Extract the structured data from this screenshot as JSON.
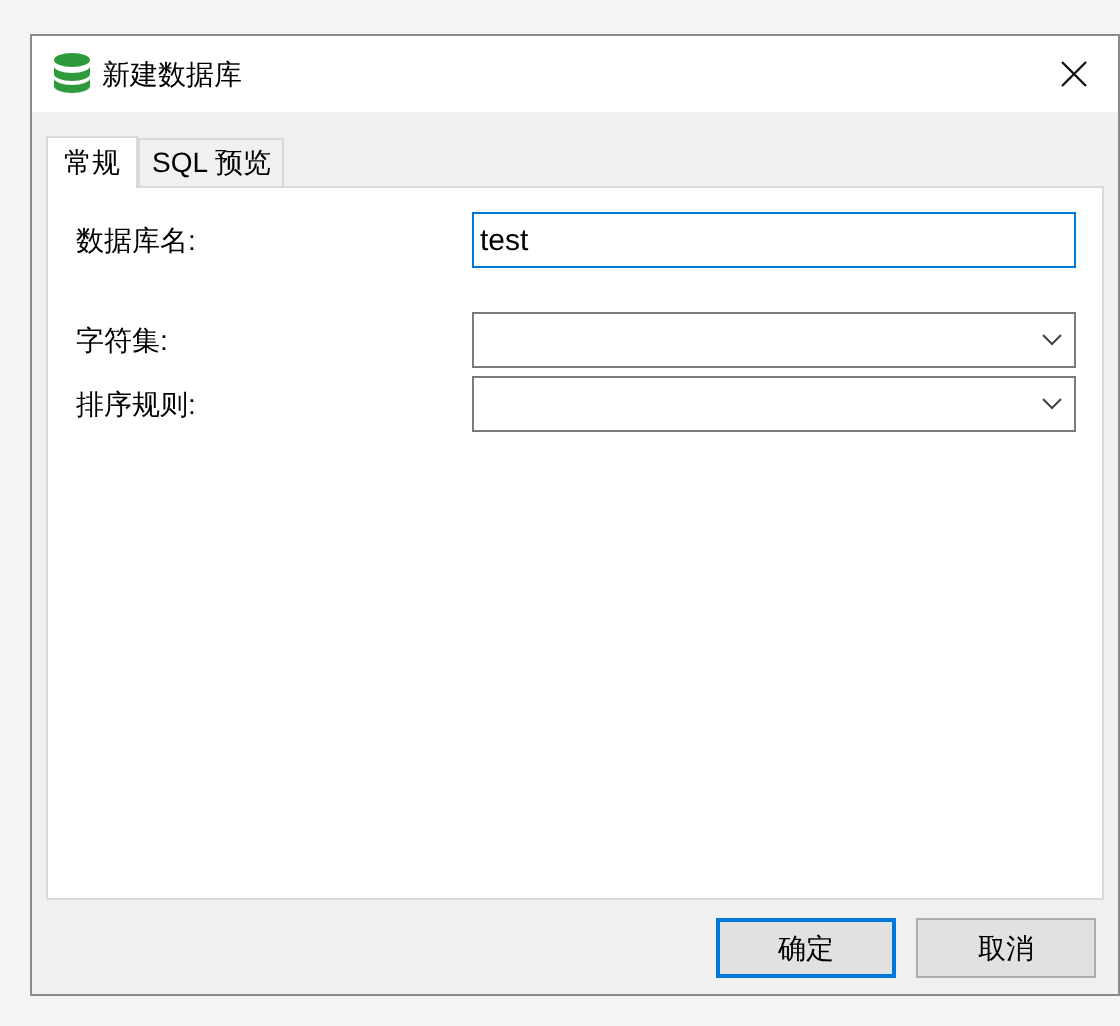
{
  "window": {
    "title": "新建数据库"
  },
  "tabs": [
    {
      "label": "常规",
      "selected": true
    },
    {
      "label": "SQL 预览",
      "selected": false
    }
  ],
  "fields": [
    {
      "kind": "text",
      "label": "数据库名:",
      "value": "test",
      "focused": true
    },
    {
      "kind": "select",
      "label": "字符集:",
      "focused": false
    },
    {
      "kind": "select",
      "label": "排序规则:",
      "focused": false
    }
  ],
  "buttons": [
    {
      "label": "确定",
      "default": true
    },
    {
      "label": "取消",
      "default": false
    }
  ]
}
